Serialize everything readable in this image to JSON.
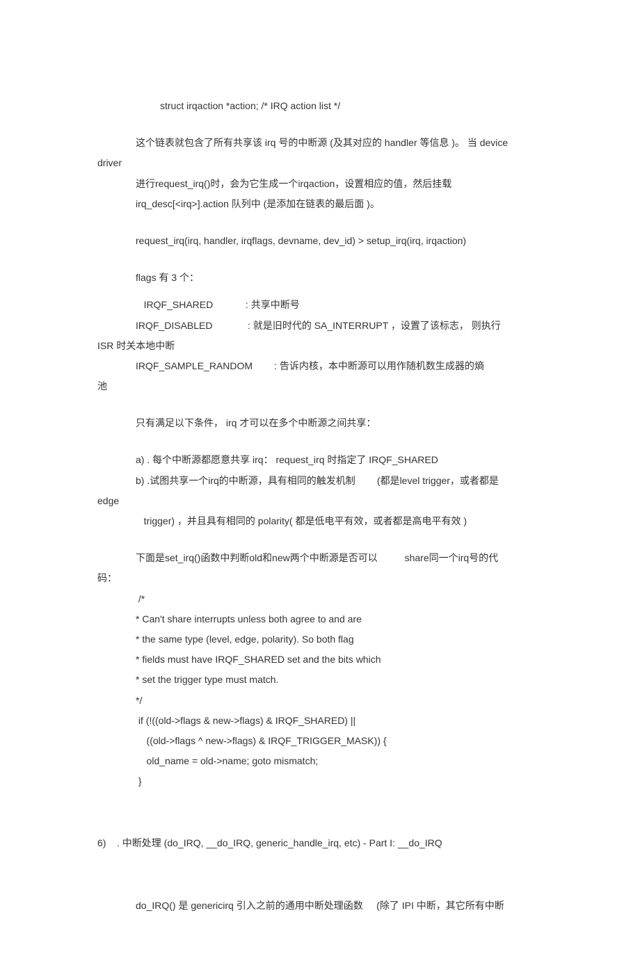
{
  "lines": {
    "l1": "struct irqaction *action; /* IRQ action list */",
    "l2": "这个链表就包含了所有共享该 irq 号的中断源 (及其对应的 handler 等信息 )。 当 device",
    "l3": "driver",
    "l4": "进行request_irq()时，会为它生成一个irqaction，设置相应的值，然后挂载",
    "l5": "irq_desc[<irq>].action 队列中 (是添加在链表的最后面 )。",
    "l6": "request_irq(irq, handler, irqflags, devname, dev_id) > setup_irq(irq, irqaction)",
    "l7": "flags 有 3 个：",
    "l8": "   IRQF_SHARED            : 共享中断号",
    "l9": "IRQF_DISABLED             : 就是旧时代的 SA_INTERRUPT ，设置了该标志， 则执行",
    "l10": "ISR 时关本地中断",
    "l11": "IRQF_SAMPLE_RANDOM        : 告诉内核，本中断源可以用作随机数生成器的熵",
    "l12": "池",
    "l13": "只有满足以下条件， irq 才可以在多个中断源之间共享：",
    "l14": "a) . 每个中断源都愿意共享 irq： request_irq 时指定了 IRQF_SHARED",
    "l15": "b) .试图共享一个irq的中断源，具有相同的触发机制        (都是level trigger，或者都是",
    "l16": "edge",
    "l17": "   trigger) ，并且具有相同的 polarity( 都是低电平有效，或者都是高电平有效 )",
    "l18": "下面是set_irq()函数中判断old和new两个中断源是否可以          share同一个irq号的代",
    "l19": "码：",
    "l20": " /*",
    "l21": "*  Can't share interrupts unless both agree to and are",
    "l22": "*  the same type (level, edge, polarity). So both flag",
    "l23": "*  fields must have IRQF_SHARED set and the bits which",
    "l24": "*  set the trigger type must match.",
    "l25": "*/",
    "l26": " if (!((old->flags & new->flags) & IRQF_SHARED) ||",
    "l27": "    ((old->flags ^ new->flags) & IRQF_TRIGGER_MASK)) {",
    "l28": "    old_name = old->name; goto mismatch;",
    "l29": " }",
    "l30": "6)    . 中断处理 (do_IRQ, __do_IRQ, generic_handle_irq, etc) - Part I: __do_IRQ",
    "l31": "do_IRQ() 是 genericirq 引入之前的通用中断处理函数     (除了 IPI 中断，其它所有中断"
  }
}
